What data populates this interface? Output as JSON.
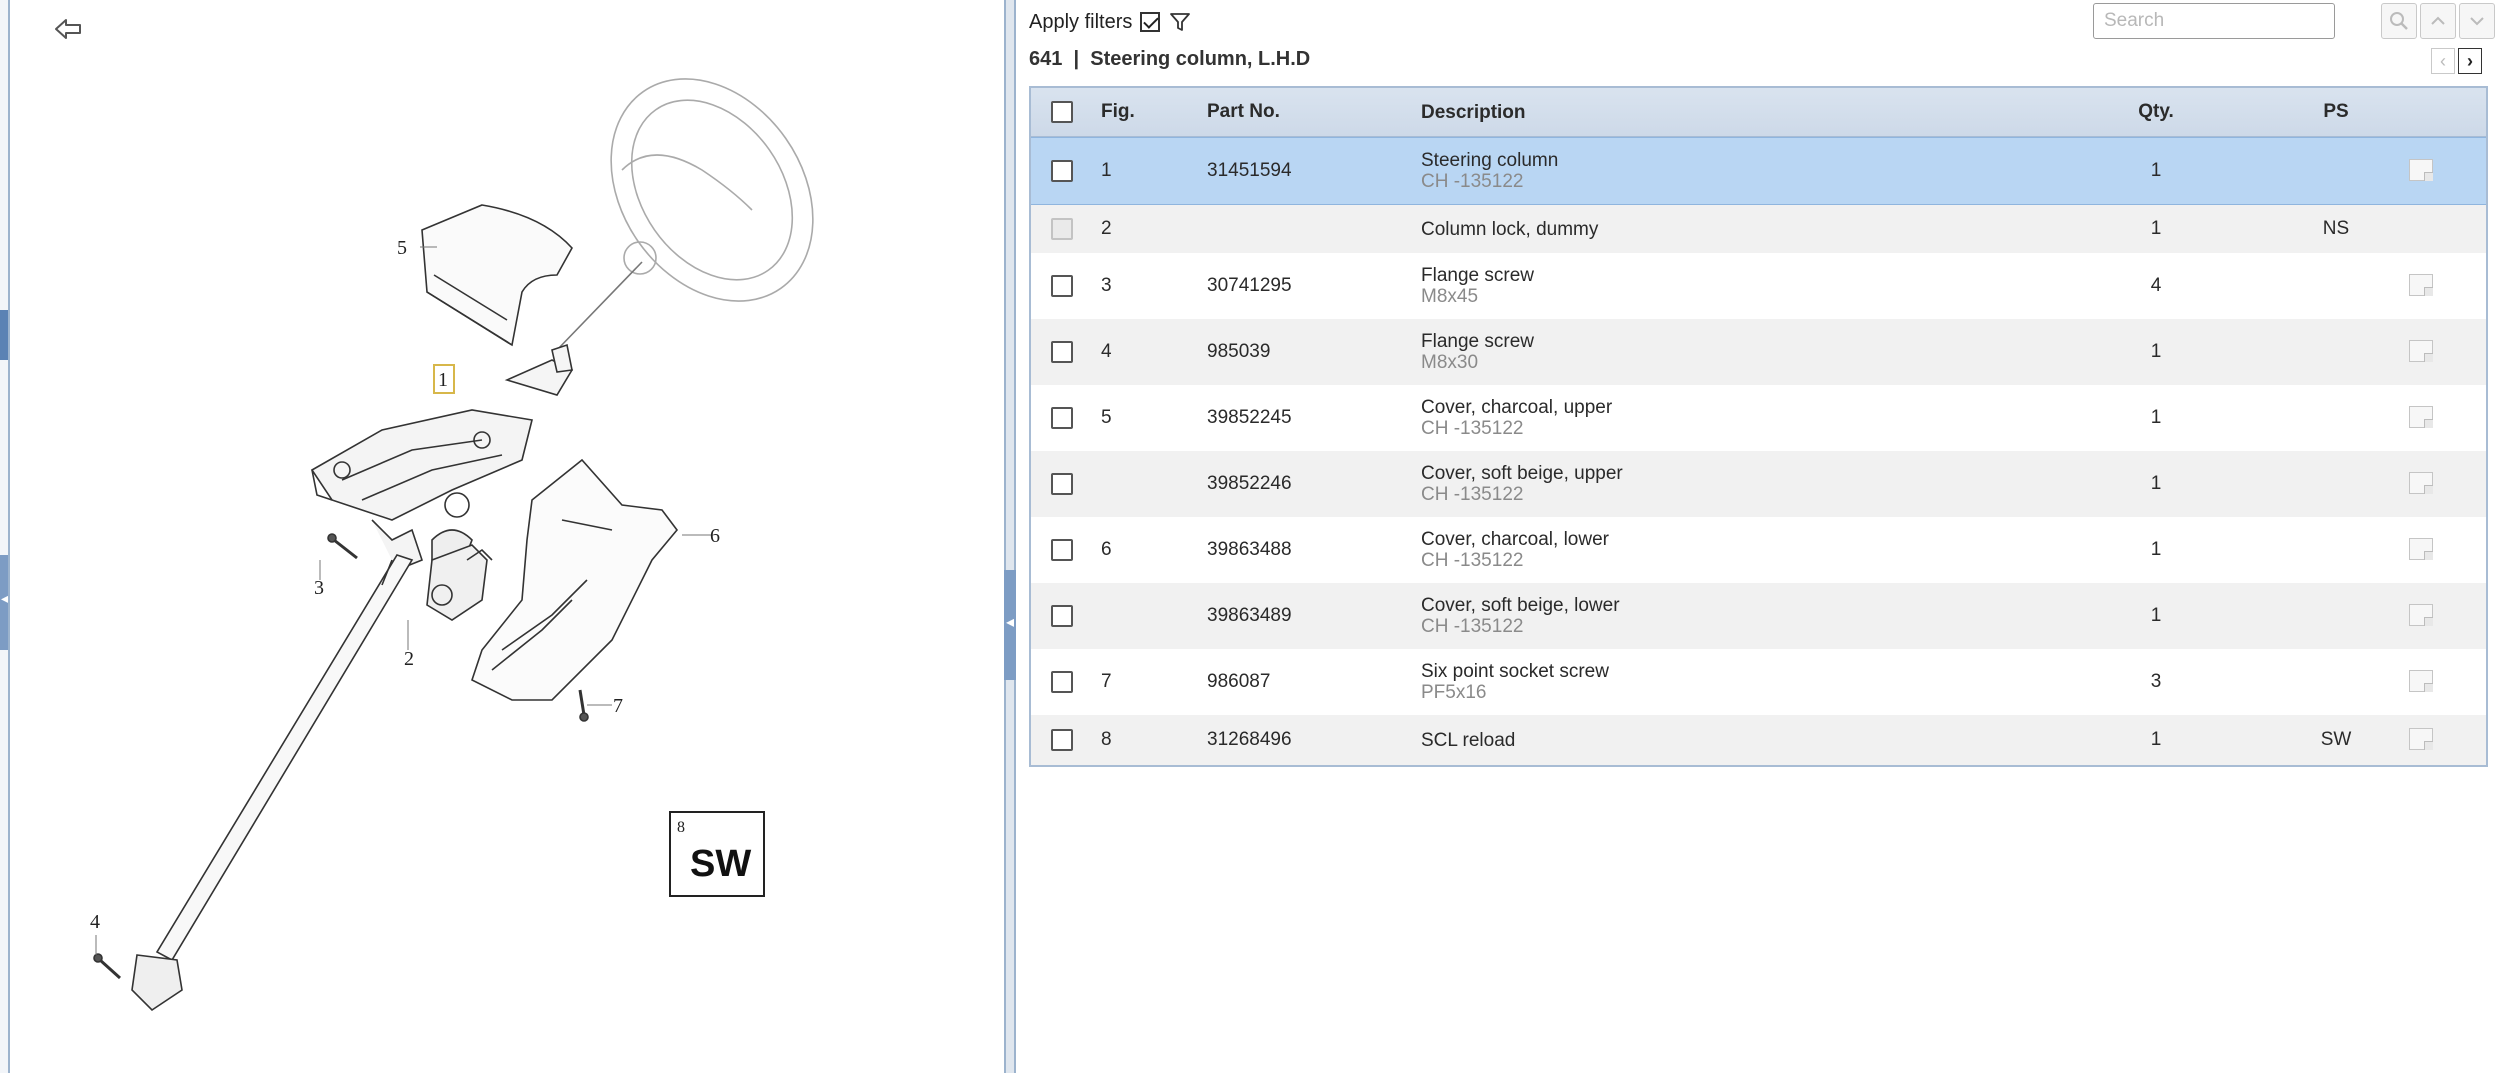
{
  "filters": {
    "apply_label": "Apply filters",
    "checked": true
  },
  "search": {
    "placeholder": "Search"
  },
  "page": {
    "number": "641",
    "separator": "|",
    "title": "Steering column, L.H.D"
  },
  "table": {
    "headers": {
      "fig": "Fig.",
      "part_no": "Part No.",
      "description": "Description",
      "qty": "Qty.",
      "ps": "PS"
    },
    "rows": [
      {
        "fig": "1",
        "part_no": "31451594",
        "desc": "Steering column",
        "sub": "CH -135122",
        "qty": "1",
        "ps": "",
        "selected": true,
        "note": true
      },
      {
        "fig": "2",
        "part_no": "",
        "desc": "Column lock, dummy",
        "sub": "",
        "qty": "1",
        "ps": "NS",
        "disabled": true,
        "note": false
      },
      {
        "fig": "3",
        "part_no": "30741295",
        "desc": "Flange screw",
        "sub": "M8x45",
        "qty": "4",
        "ps": "",
        "note": true
      },
      {
        "fig": "4",
        "part_no": "985039",
        "desc": "Flange screw",
        "sub": "M8x30",
        "qty": "1",
        "ps": "",
        "note": true
      },
      {
        "fig": "5",
        "part_no": "39852245",
        "desc": "Cover, charcoal, upper",
        "sub": "CH -135122",
        "qty": "1",
        "ps": "",
        "note": true
      },
      {
        "fig": "",
        "part_no": "39852246",
        "desc": "Cover, soft beige, upper",
        "sub": "CH -135122",
        "qty": "1",
        "ps": "",
        "note": true
      },
      {
        "fig": "6",
        "part_no": "39863488",
        "desc": "Cover, charcoal, lower",
        "sub": "CH -135122",
        "qty": "1",
        "ps": "",
        "note": true
      },
      {
        "fig": "",
        "part_no": "39863489",
        "desc": "Cover, soft beige, lower",
        "sub": "CH -135122",
        "qty": "1",
        "ps": "",
        "note": true
      },
      {
        "fig": "7",
        "part_no": "986087",
        "desc": "Six point socket screw",
        "sub": "PF5x16",
        "qty": "3",
        "ps": "",
        "note": true
      },
      {
        "fig": "8",
        "part_no": "31268496",
        "desc": "SCL reload",
        "sub": "",
        "qty": "1",
        "ps": "SW",
        "note": true
      }
    ]
  },
  "diagram": {
    "callouts": [
      "1",
      "2",
      "3",
      "4",
      "5",
      "6",
      "7",
      "8"
    ],
    "sw_box_label": "SW"
  },
  "colors": {
    "selected_row": "#b9d6f3",
    "header": "#d2dde9",
    "border": "#a8bcd4"
  }
}
